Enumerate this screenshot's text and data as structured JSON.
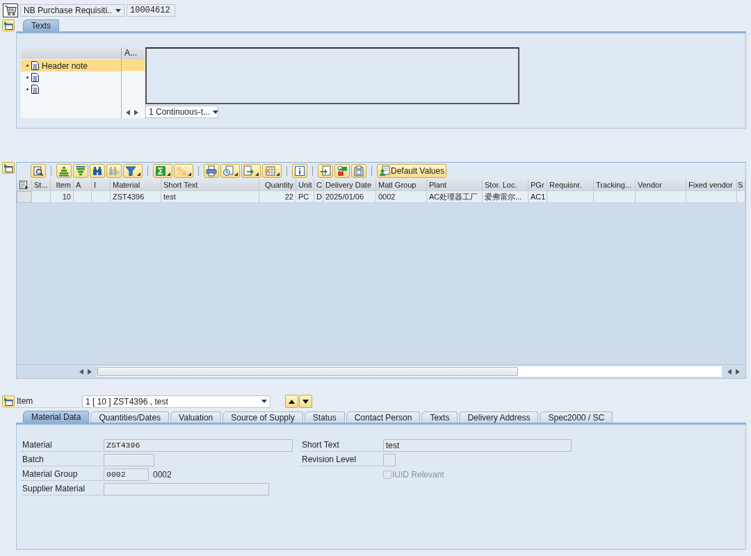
{
  "header": {
    "document_type": "NB Purchase Requisiti..",
    "document_number": "10004612"
  },
  "header_section": {
    "tabs": [
      {
        "label": "Texts",
        "selected": true
      }
    ],
    "text_tree": {
      "column_2": "A...",
      "items": [
        {
          "label": "Header note",
          "selected": true
        },
        {
          "selected": false
        },
        {
          "selected": false
        }
      ]
    },
    "text_format": "1 Continuous-t..."
  },
  "items_section": {
    "toolbar": [
      {
        "buttons": [
          {
            "kind": "icon",
            "disabled": false,
            "menu": false
          }
        ]
      },
      {
        "buttons": [
          {
            "kind": "icon",
            "disabled": false,
            "menu": false
          },
          {
            "kind": "icon",
            "disabled": false,
            "menu": false
          },
          {
            "kind": "icon",
            "disabled": false,
            "menu": false
          },
          {
            "kind": "icon",
            "disabled": true,
            "menu": false
          },
          {
            "kind": "icon",
            "disabled": false,
            "menu": true
          }
        ]
      },
      {
        "buttons": [
          {
            "kind": "icon",
            "disabled": false,
            "menu": true
          },
          {
            "kind": "icon",
            "disabled": true,
            "menu": true
          }
        ]
      },
      {
        "buttons": [
          {
            "kind": "icon",
            "disabled": false,
            "menu": false
          },
          {
            "kind": "icon",
            "disabled": false,
            "menu": true
          },
          {
            "kind": "icon",
            "disabled": false,
            "menu": true
          },
          {
            "kind": "icon",
            "disabled": false,
            "menu": true
          }
        ]
      },
      {
        "buttons": [
          {
            "kind": "icon",
            "disabled": false,
            "menu": false
          }
        ]
      },
      {
        "buttons": [
          {
            "kind": "icon",
            "disabled": false,
            "menu": false
          },
          {
            "kind": "icon",
            "disabled": false,
            "menu": false
          },
          {
            "kind": "icon",
            "disabled": false,
            "menu": false
          }
        ]
      },
      {
        "buttons": [
          {
            "kind": "text",
            "label": "Default Values",
            "disabled": false,
            "menu": false
          }
        ]
      }
    ],
    "table": {
      "columns": [
        "St...",
        "Item",
        "A",
        "I",
        "Material",
        "Short Text",
        "Quantity",
        "Unit",
        "C",
        "Delivery Date",
        "Matl Group",
        "Plant",
        "Stor. Loc.",
        "PGr",
        "Requisnr.",
        "Tracking...",
        "Vendor",
        "Fixed vendor",
        "S"
      ],
      "rows": [
        {
          "selected": false,
          "cells": [
            null,
            "10",
            null,
            null,
            "ZST4396",
            "test",
            "22",
            "PC",
            "D",
            "2025/01/06",
            "0002",
            "AC处理器工厂",
            "爱弗雷尔...",
            "AC1",
            null,
            null,
            null,
            null,
            null
          ]
        }
      ]
    }
  },
  "item_section": {
    "label": "Item",
    "item_selector": "1 [ 10 ] ZST4396 , test",
    "tabs": [
      {
        "label": "Material Data",
        "selected": true
      },
      {
        "label": "Quantities/Dates",
        "selected": false
      },
      {
        "label": "Valuation",
        "selected": false
      },
      {
        "label": "Source of Supply",
        "selected": false
      },
      {
        "label": "Status",
        "selected": false
      },
      {
        "label": "Contact Person",
        "selected": false
      },
      {
        "label": "Texts",
        "selected": false
      },
      {
        "label": "Delivery Address",
        "selected": false
      },
      {
        "label": "Spec2000 / SC",
        "selected": false
      }
    ],
    "fields_left": [
      {
        "kind": "field",
        "label": "Material",
        "value": "ZST4396"
      },
      {
        "kind": "field",
        "label": "Batch"
      },
      {
        "kind": "field",
        "label": "Material Group",
        "value": "0002",
        "description": "0002"
      },
      {
        "kind": "field",
        "label": "Supplier Material"
      }
    ],
    "fields_right": [
      {
        "kind": "field",
        "label": "Short Text",
        "value": "test"
      },
      {
        "kind": "field",
        "label": "Revision Level"
      },
      {
        "kind": "checkbox",
        "label": "IUID Relevant",
        "checked": false,
        "disabled": true
      }
    ]
  }
}
